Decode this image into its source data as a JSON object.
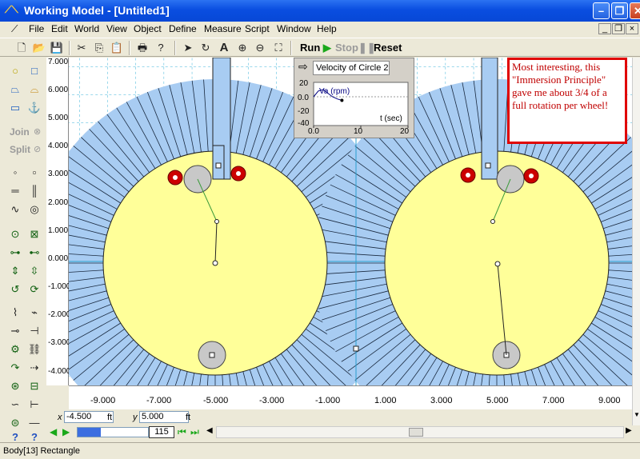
{
  "window": {
    "title": "Working Model - [Untitled1]"
  },
  "menu": [
    "File",
    "Edit",
    "World",
    "View",
    "Object",
    "Define",
    "Measure",
    "Script",
    "Window",
    "Help"
  ],
  "toolbar": {
    "run": "Run",
    "stop": "Stop",
    "reset": "Reset"
  },
  "palette": {
    "join": "Join",
    "split": "Split"
  },
  "ruler_y": [
    "7.000",
    "6.000",
    "5.000",
    "4.000",
    "3.000",
    "2.000",
    "1.000",
    "0.000",
    "-1.000",
    "-2.000",
    "-3.000",
    "-4.000"
  ],
  "ruler_x": [
    "-9.000",
    "-7.000",
    "-5.000",
    "-3.000",
    "-1.000",
    "1.000",
    "3.000",
    "5.000",
    "7.000",
    "9.000"
  ],
  "coords": {
    "x_label": "x",
    "x_value": "-4.500",
    "x_unit": "ft",
    "y_label": "y",
    "y_value": "5.000",
    "y_unit": "ft"
  },
  "playback": {
    "frame": "115",
    "progress": 0.33
  },
  "status": {
    "text": "Body[13]  Rectangle"
  },
  "annotation": {
    "text": "Most interesting, this \"Immersion Principle\" gave me about 3/4 of a full rotation per wheel!"
  },
  "meter": {
    "title": "Velocity of Circle 2",
    "series_label": "Va (rpm)",
    "xlabel": "t (sec)",
    "y_ticks": [
      "20",
      "0.0",
      "-20",
      "-40"
    ],
    "x_ticks": [
      "0.0",
      "10",
      "20"
    ]
  },
  "chart_data": {
    "type": "line",
    "title": "Velocity of Circle 2",
    "xlabel": "t (sec)",
    "ylabel": "Va (rpm)",
    "xlim": [
      0,
      20
    ],
    "ylim": [
      -40,
      20
    ],
    "series": [
      {
        "name": "Va (rpm)",
        "x": [
          0,
          1,
          2,
          3,
          4,
          5,
          6
        ],
        "y": [
          0,
          8,
          10,
          5,
          0,
          -3,
          -5
        ]
      }
    ]
  },
  "colors": {
    "water": "#a8ccf2",
    "wheel": "#ffff99",
    "pin": "#cc0000",
    "annotation_border": "#e00000",
    "titlebar": "#0a4ee0"
  }
}
